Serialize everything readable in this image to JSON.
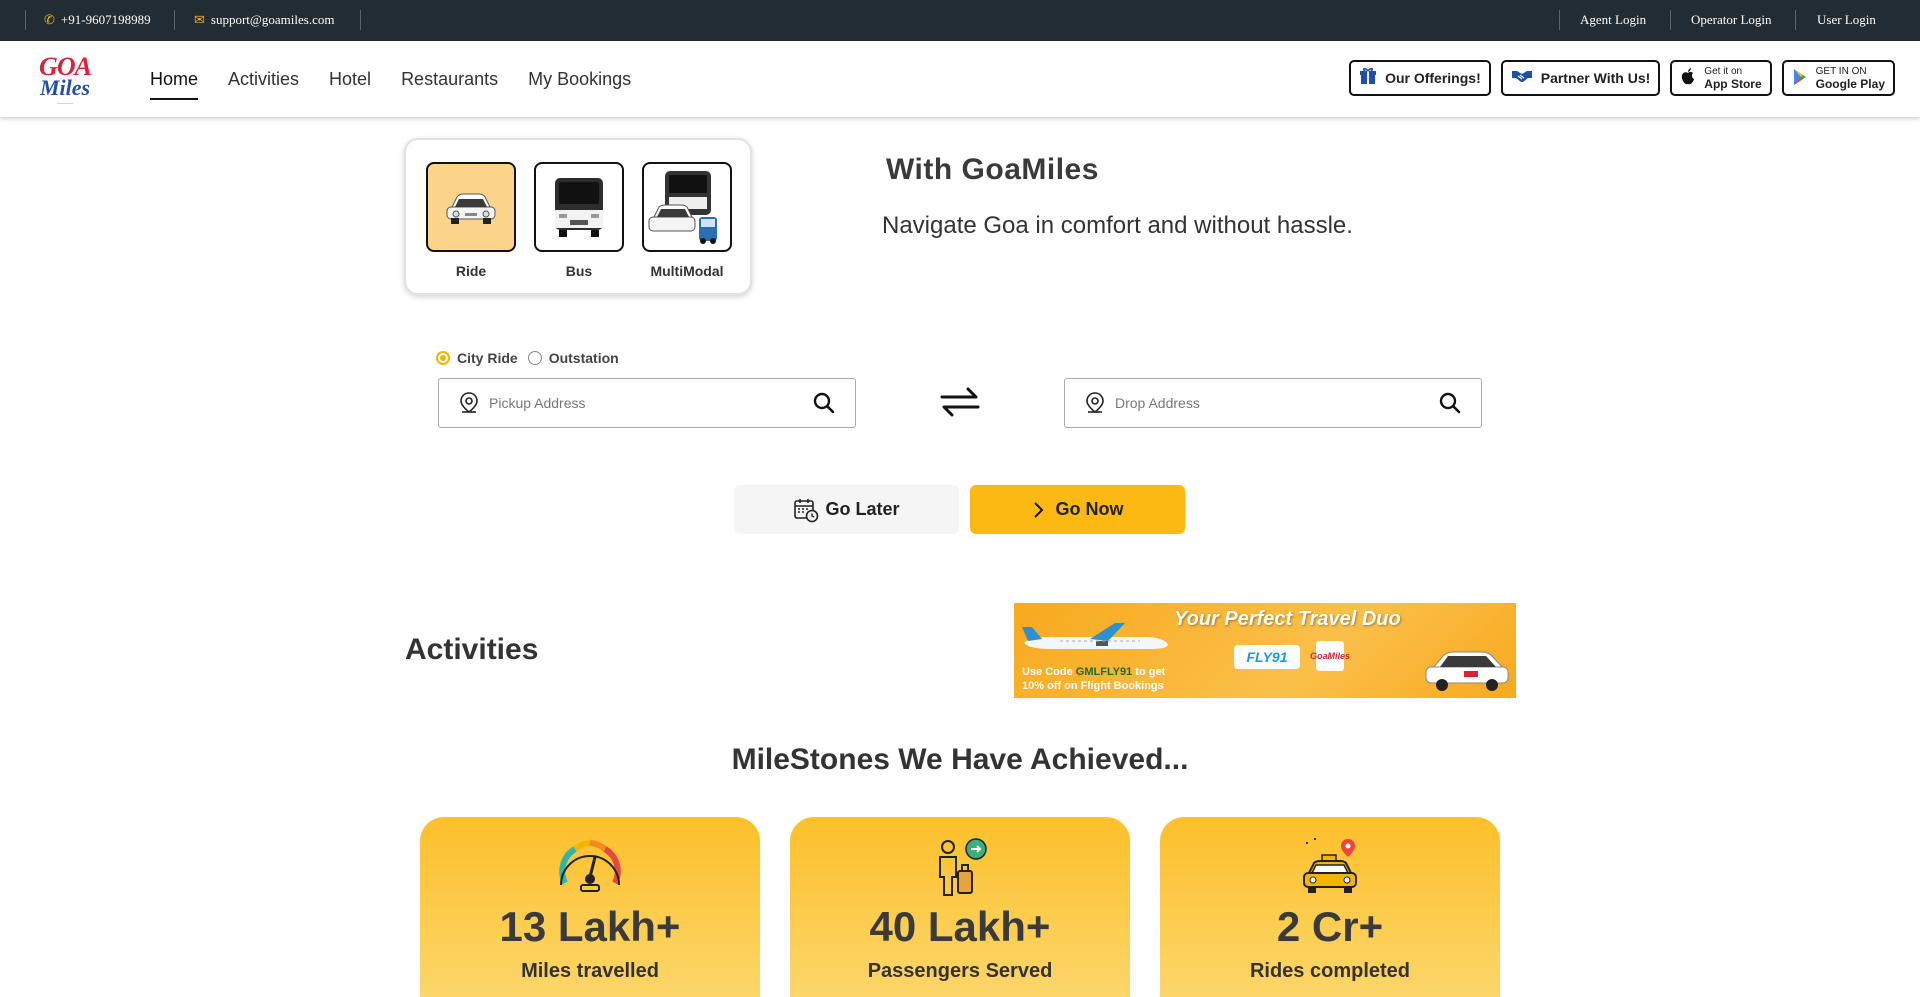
{
  "topbar": {
    "phone": "+91-9607198989",
    "email": "support@goamiles.com",
    "agent_login": "Agent Login",
    "operator_login": "Operator Login",
    "user_login": "User Login"
  },
  "header": {
    "logo": {
      "line1": "GOA",
      "line2": "Miles"
    },
    "nav": [
      "Home",
      "Activities",
      "Hotel",
      "Restaurants",
      "My Bookings"
    ],
    "active_nav": "Home",
    "offerings_label": "Our Offerings!",
    "partner_label": "Partner With Us!",
    "appstore": {
      "small": "Get it on",
      "big": "App Store"
    },
    "playstore": {
      "small": "GET IN ON",
      "big": "Google Play"
    }
  },
  "modes": [
    {
      "label": "Ride",
      "icon": "car-icon",
      "selected": true
    },
    {
      "label": "Bus",
      "icon": "bus-icon",
      "selected": false
    },
    {
      "label": "MultiModal",
      "icon": "multimodal-icon",
      "selected": false
    }
  ],
  "hero": {
    "title": "With GoaMiles",
    "subtitle": "Navigate Goa in comfort and without hassle."
  },
  "booking": {
    "ride_types": [
      "City Ride",
      "Outstation"
    ],
    "selected_ride_type": "City Ride",
    "pickup_placeholder": "Pickup Address",
    "drop_placeholder": "Drop Address",
    "go_later_label": "Go Later",
    "go_now_label": "Go Now"
  },
  "activities": {
    "title": "Activities"
  },
  "banner": {
    "title": "Your Perfect Travel Duo",
    "code_prefix": "Use Code ",
    "code": "GMLFLY91",
    "code_suffix": " to get",
    "line2": "10% off on Flight Bookings",
    "airline": "FLY91",
    "brand": "GoaMiles"
  },
  "milestones": {
    "title": "MileStones We Have Achieved...",
    "stats": [
      {
        "value": "13 Lakh+",
        "label": "Miles travelled",
        "icon": "speedometer-icon"
      },
      {
        "value": "40 Lakh+",
        "label": "Passengers Served",
        "icon": "passenger-icon"
      },
      {
        "value": "2 Cr+",
        "label": "Rides completed",
        "icon": "taxi-icon"
      }
    ]
  },
  "colors": {
    "accent": "#fcb913",
    "topbar_bg": "#212c34",
    "selected_mode_bg": "#fcd38b"
  }
}
